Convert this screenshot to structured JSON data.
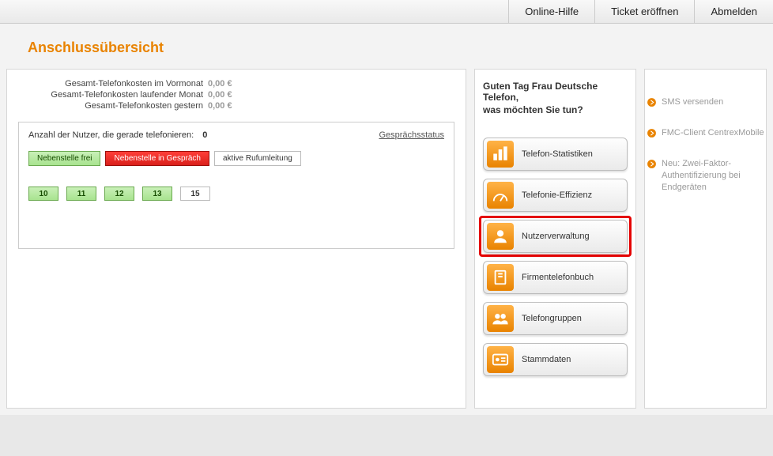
{
  "topnav": {
    "help": "Online-Hilfe",
    "ticket": "Ticket eröffnen",
    "logout": "Abmelden"
  },
  "title": "Anschlussübersicht",
  "costs": {
    "prev_month_label": "Gesamt-Telefonkosten im Vormonat",
    "prev_month_value": "0,00 €",
    "curr_month_label": "Gesamt-Telefonkosten laufender Monat",
    "curr_month_value": "0,00 €",
    "yesterday_label": "Gesamt-Telefonkosten gestern",
    "yesterday_value": "0,00 €"
  },
  "panel": {
    "active_label": "Anzahl der Nutzer, die gerade telefonieren:",
    "active_count": "0",
    "status_link": "Gesprächsstatus",
    "legend_free": "Nebenstelle frei",
    "legend_busy": "Nebenstelle in Gespräch",
    "legend_fwd": "aktive Rufumleitung",
    "extensions": [
      {
        "n": "10",
        "state": "green"
      },
      {
        "n": "11",
        "state": "green"
      },
      {
        "n": "12",
        "state": "green"
      },
      {
        "n": "13",
        "state": "green"
      },
      {
        "n": "15",
        "state": "white"
      }
    ]
  },
  "greeting": {
    "line1": "Guten Tag Frau Deutsche Telefon,",
    "line2": "was möchten Sie tun?"
  },
  "actions": {
    "stats": "Telefon-Statistiken",
    "efficiency": "Telefonie-Effizienz",
    "users": "Nutzerverwaltung",
    "phonebook": "Firmentelefonbuch",
    "groups": "Telefongruppen",
    "master": "Stammdaten"
  },
  "sidelinks": {
    "sms": "SMS versenden",
    "fmc": "FMC-Client CentrexMobile",
    "twofa": "Neu: Zwei-Faktor-Authentifizierung bei Endgeräten"
  }
}
